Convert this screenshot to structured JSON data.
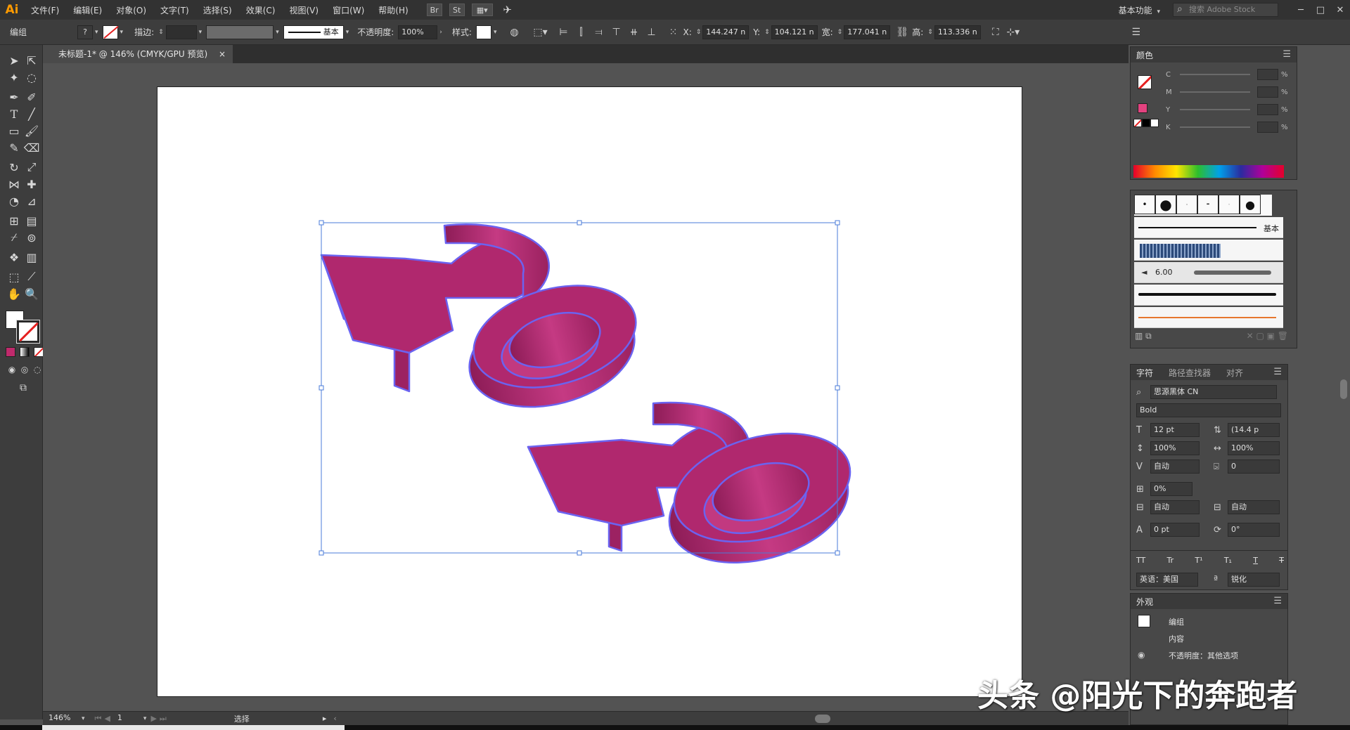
{
  "menubar": {
    "logo": "Ai",
    "items": [
      "文件(F)",
      "编辑(E)",
      "对象(O)",
      "文字(T)",
      "选择(S)",
      "效果(C)",
      "视图(V)",
      "窗口(W)",
      "帮助(H)"
    ],
    "bridge_label": "Br",
    "stock_label": "St",
    "workspace": "基本功能",
    "stock_search_placeholder": "搜索 Adobe Stock",
    "win_min": "─",
    "win_max": "□",
    "win_close": "✕"
  },
  "control": {
    "selection_type": "编组",
    "stroke_label": "描边:",
    "stroke_profile": "基本",
    "opacity_label": "不透明度:",
    "opacity_value": "100%",
    "style_label": "样式:",
    "x_label": "X:",
    "x_value": "144.247 n",
    "y_label": "Y:",
    "y_value": "104.121 n",
    "w_label": "宽:",
    "w_value": "177.041 n",
    "h_label": "高:",
    "h_value": "113.336 n"
  },
  "document": {
    "tab_title": "未标题-1* @ 146% (CMYK/GPU 预览)",
    "close_glyph": "×"
  },
  "status": {
    "zoom": "146%",
    "artboard_number": "1",
    "tool_status": "选择"
  },
  "panels": {
    "color": {
      "title": "颜色",
      "channels": [
        "C",
        "M",
        "Y",
        "K"
      ],
      "pct": "%"
    },
    "brushes": {
      "basic_label": "基本",
      "size_label": "6.00"
    },
    "character": {
      "tabs": [
        "字符",
        "路径查找器",
        "对齐"
      ],
      "font_family": "思源黑体 CN",
      "font_style": "Bold",
      "font_size": "12 pt",
      "leading": "(14.4 p",
      "vertical_scale": "100%",
      "horizontal_scale": "100%",
      "kerning": "自动",
      "tracking": "0",
      "tsume": "0%",
      "aki_left": "自动",
      "aki_right": "自动",
      "baseline_shift": "0 pt",
      "rotation": "0°",
      "language": "英语：美国",
      "antialias": "锐化",
      "type_buttons": [
        "TT",
        "Tr",
        "T¹",
        "T₁",
        "T",
        "T"
      ]
    },
    "appearance": {
      "title": "外观",
      "group_label": "编组",
      "contents_label": "内容",
      "opacity_label": "不透明度：其他选项"
    }
  },
  "watermark": "头条 @阳光下的奔跑者",
  "colors": {
    "art_fill": "#b0286e",
    "art_stroke": "#6b63f0",
    "fill_swatch": "#e3427f"
  }
}
